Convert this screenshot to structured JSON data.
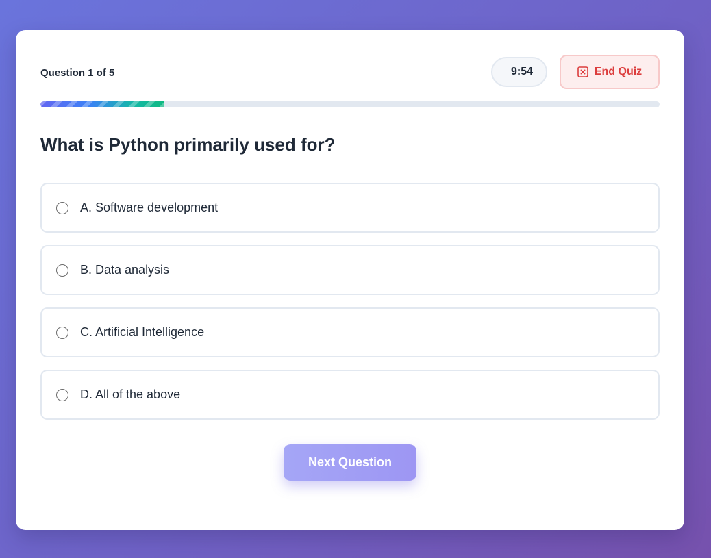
{
  "quiz": {
    "counter_text": "Question 1 of 5",
    "timer": "9:54",
    "end_label": "End Quiz",
    "progress_fraction": 0.2,
    "question": "What is Python primarily used for?",
    "options": [
      {
        "label": "A. Software development"
      },
      {
        "label": "B. Data analysis"
      },
      {
        "label": "C. Artificial Intelligence"
      },
      {
        "label": "D. All of the above"
      }
    ],
    "next_label": "Next Question"
  },
  "colors": {
    "danger": "#dc3d3d",
    "accent": "#9d96f3",
    "background_start": "#6a74dc",
    "background_end": "#7651ad"
  },
  "icons": {
    "end_quiz": "close-square-icon",
    "option_radio": "radio-unchecked-icon"
  }
}
